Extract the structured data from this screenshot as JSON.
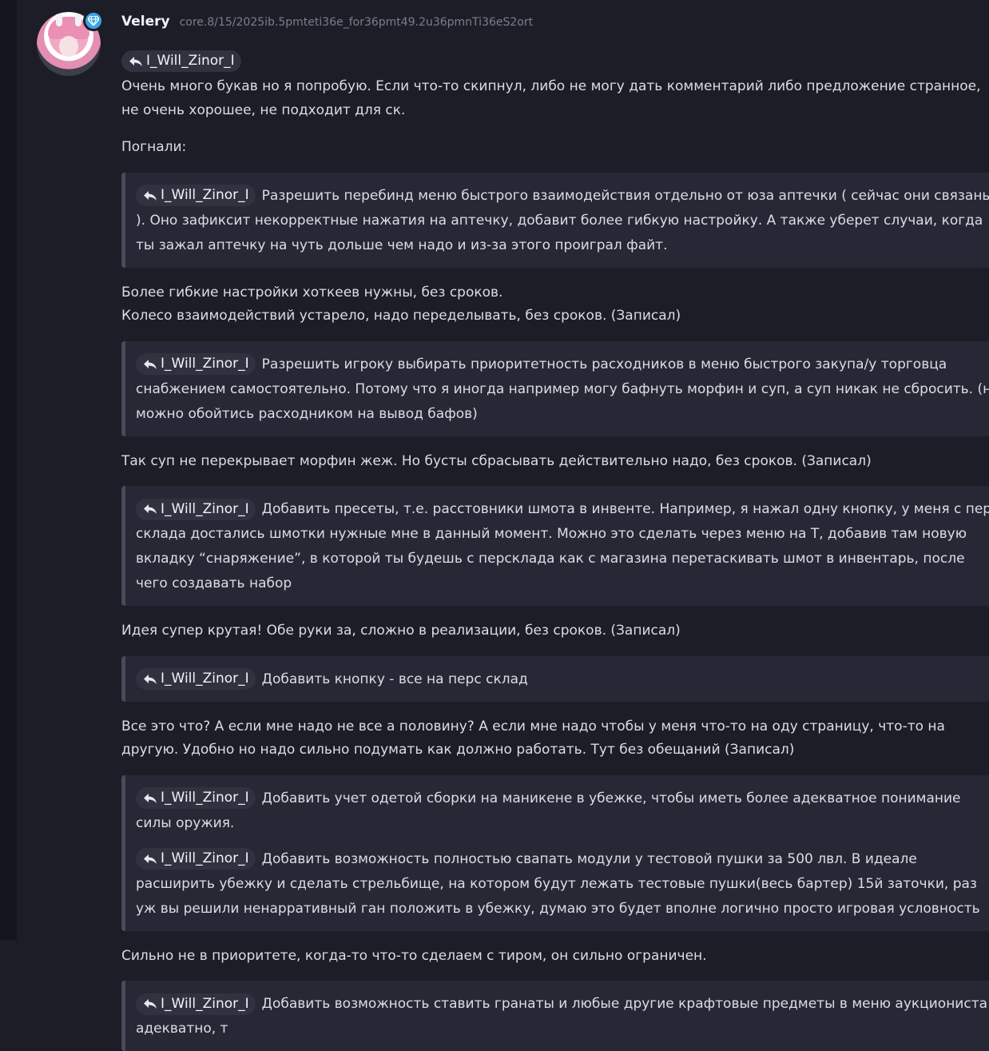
{
  "post": {
    "author": "Velery",
    "meta": "core.8/15/2025ib.5pmteti36e_for36pmt49.2u36pmnTi36eS2ort",
    "reply_to": "I_Will_Zinor_I",
    "intro": "Очень много букав но я попробую. Если что-то скипнул, либо не могу дать комментарий либо предложение странное, не очень хорошее, не подходит для ск.",
    "go": "Погнали:",
    "quotes": [
      {
        "mention": "I_Will_Zinor_I",
        "text": "Разрешить перебинд меню быстрого взаимодействия отдельно от юза аптечки ( сейчас они связаны ). Оно зафиксит некорректные нажатия на аптечку, добавит более гибкую настройку. А также уберет случаи, когда ты зажал аптечку на чуть дольше чем надо и из-за этого проиграл файт."
      },
      {
        "mention": "I_Will_Zinor_I",
        "text": "Разрешить игроку выбирать приоритетность расходников в меню быстрого закупа/у торговца снабжением самостоятельно. Потому что я иногда например могу бафнуть морфин и суп, а суп никак не сбросить. (но можно обойтись расходником на вывод бафов)"
      },
      {
        "mention": "I_Will_Zinor_I",
        "text": "Добавить пресеты, т.е. расстовники шмота в инвенте. Например, я нажал одну кнопку, у меня с перс склада достались шмотки нужные мне в данный момент. Можно это сделать через меню на T, добавив там новую вкладку “снаряжение”, в которой ты будешь с персклада как с магазина перетаскивать шмот в инвентарь, после чего создавать набор"
      },
      {
        "mention": "I_Will_Zinor_I",
        "text": "Добавить кнопку - все на перс склад"
      },
      {
        "mention": "I_Will_Zinor_I",
        "text": "Добавить учет одетой сборки на маникене в убежке, чтобы иметь более адекватное понимание силы оружия."
      },
      {
        "mention": "I_Will_Zinor_I",
        "text": "Добавить возможность полностью свапать модули у тестовой пушки за 500 лвл. В идеале расширить убежку и сделать стрельбище, на котором будут лежать тестовые пушки(весь бартер) 15й заточки, раз уж вы решили ненарративный ган положить в убежку, думаю это будет вполне логично просто игровая условность"
      },
      {
        "mention": "I_Will_Zinor_I",
        "text": "Добавить возможность ставить гранаты и любые другие крафтовые предметы в меню аукциониста адекватно, т"
      }
    ],
    "answers": [
      "Более гибкие настройки хоткеев нужны, без сроков.",
      "Колесо взаимодействий устарело, надо переделывать, без сроков. (Записал)",
      "Так суп не перекрывает морфин жеж. Но бусты сбрасывать действительно надо, без сроков. (Записал)",
      "Идея супер крутая! Обе руки за, сложно в реализации, без сроков. (Записал)",
      "Все это что? А если мне надо не все а половину? А если мне надо чтобы у меня что-то на оду страницу, что-то на другую. Удобно но надо сильно подумать как должно работать. Тут без обещаний (Записал)",
      "Сильно не в приоритете, когда-то что-то сделаем с тиром, он сильно ограничен."
    ]
  },
  "icons": {
    "reply": "reply-arrow-icon",
    "badge": "diamond-badge-icon"
  },
  "colors": {
    "background": "#1c1d26",
    "quote_bg": "#262835",
    "quote_border": "#494b59",
    "mention_bg": "#30323f",
    "badge": "#3ba4e6"
  }
}
